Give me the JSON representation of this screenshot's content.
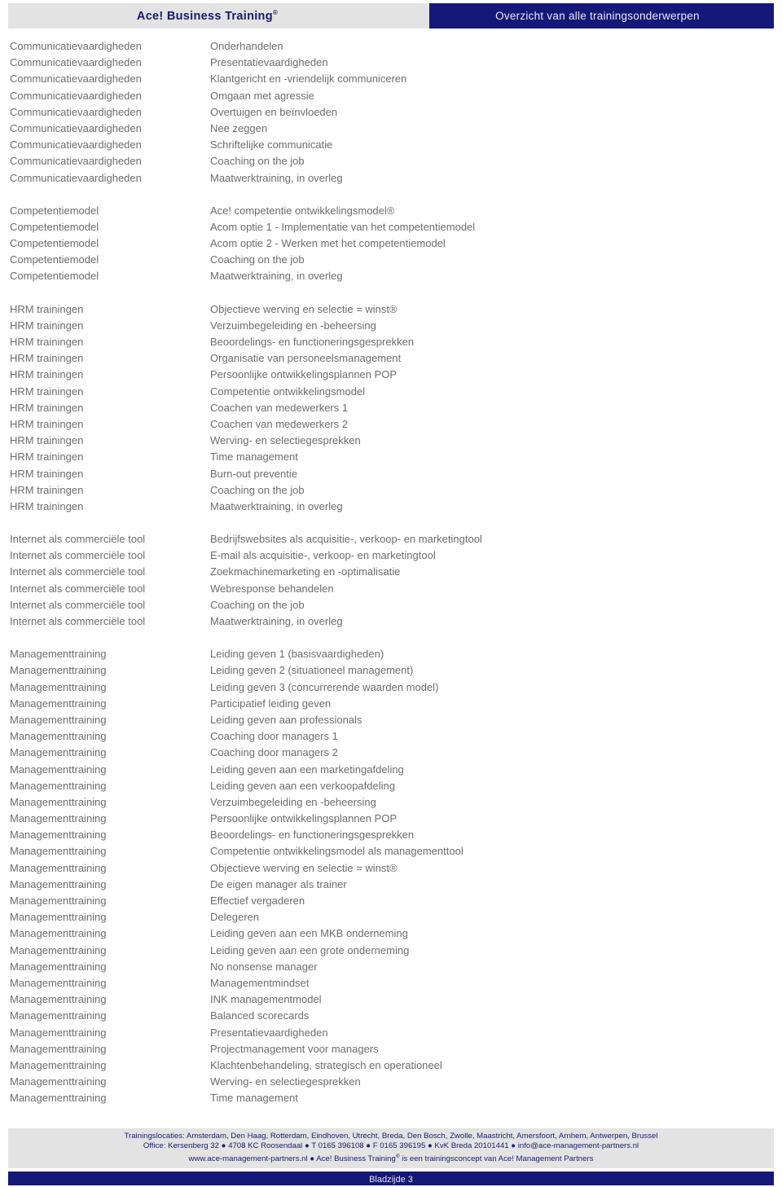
{
  "header": {
    "brand": "Ace! Business Training",
    "brand_mark": "®",
    "title": "Overzicht van alle trainingsonderwerpen"
  },
  "groups": [
    {
      "category": "Communicatievaardigheden",
      "rows": [
        {
          "category": "Communicatievaardigheden",
          "topic": "Onderhandelen"
        },
        {
          "category": "Communicatievaardigheden",
          "topic": "Presentatievaardigheden"
        },
        {
          "category": "Communicatievaardigheden",
          "topic": "Klantgericht en -vriendelijk communiceren"
        },
        {
          "category": "Communicatievaardigheden",
          "topic": "Omgaan met agressie"
        },
        {
          "category": "Communicatievaardigheden",
          "topic": "Overtuigen en beïnvloeden"
        },
        {
          "category": "Communicatievaardigheden",
          "topic": "Nee zeggen"
        },
        {
          "category": "Communicatievaardigheden",
          "topic": "Schriftelijke communicatie"
        },
        {
          "category": "Communicatievaardigheden",
          "topic": "Coaching on the job"
        },
        {
          "category": "Communicatievaardigheden",
          "topic": "Maatwerktraining, in overleg"
        }
      ]
    },
    {
      "category": "Competentiemodel",
      "rows": [
        {
          "category": "Competentiemodel",
          "topic": "Ace! competentie ontwikkelingsmodel®"
        },
        {
          "category": "Competentiemodel",
          "topic": "Acom optie 1 - Implementatie van het competentiemodel"
        },
        {
          "category": "Competentiemodel",
          "topic": "Acom optie 2 - Werken met het competentiemodel"
        },
        {
          "category": "Competentiemodel",
          "topic": "Coaching on the job"
        },
        {
          "category": "Competentiemodel",
          "topic": "Maatwerktraining, in overleg"
        }
      ]
    },
    {
      "category": "HRM trainingen",
      "rows": [
        {
          "category": "HRM trainingen",
          "topic": "Objectieve werving en selectie = winst®"
        },
        {
          "category": "HRM trainingen",
          "topic": "Verzuimbegeleiding en -beheersing"
        },
        {
          "category": "HRM trainingen",
          "topic": "Beoordelings- en functioneringsgesprekken"
        },
        {
          "category": "HRM trainingen",
          "topic": "Organisatie van personeelsmanagement"
        },
        {
          "category": "HRM trainingen",
          "topic": "Persoonlijke ontwikkelingsplannen POP"
        },
        {
          "category": "HRM trainingen",
          "topic": "Competentie ontwikkelingsmodel"
        },
        {
          "category": "HRM trainingen",
          "topic": "Coachen van medewerkers 1"
        },
        {
          "category": "HRM trainingen",
          "topic": "Coachen van medewerkers 2"
        },
        {
          "category": "HRM trainingen",
          "topic": "Werving- en selectiegesprekken"
        },
        {
          "category": "HRM trainingen",
          "topic": "Time management"
        },
        {
          "category": "HRM trainingen",
          "topic": "Burn-out preventie"
        },
        {
          "category": "HRM trainingen",
          "topic": "Coaching on the job"
        },
        {
          "category": "HRM trainingen",
          "topic": "Maatwerktraining, in overleg"
        }
      ]
    },
    {
      "category": "Internet als commerciële tool",
      "rows": [
        {
          "category": "Internet als commerciële tool",
          "topic": "Bedrijfswebsites als acquisitie-, verkoop- en marketingtool"
        },
        {
          "category": "Internet als commerciële tool",
          "topic": "E-mail als acquisitie-, verkoop- en marketingtool"
        },
        {
          "category": "Internet als commerciële tool",
          "topic": "Zoekmachinemarketing en -optimalisatie"
        },
        {
          "category": "Internet als commerciële tool",
          "topic": "Webresponse behandelen"
        },
        {
          "category": "Internet als commerciële tool",
          "topic": "Coaching on the job"
        },
        {
          "category": "Internet als commerciële tool",
          "topic": "Maatwerktraining, in overleg"
        }
      ]
    },
    {
      "category": "Managementtraining",
      "rows": [
        {
          "category": "Managementtraining",
          "topic": "Leiding geven 1 (basisvaardigheden)"
        },
        {
          "category": "Managementtraining",
          "topic": "Leiding geven 2 (situationeel management)"
        },
        {
          "category": "Managementtraining",
          "topic": "Leiding geven 3 (concurrerende waarden model)"
        },
        {
          "category": "Managementtraining",
          "topic": "Participatief leiding geven"
        },
        {
          "category": "Managementtraining",
          "topic": "Leiding geven aan professionals"
        },
        {
          "category": "Managementtraining",
          "topic": "Coaching door managers 1"
        },
        {
          "category": "Managementtraining",
          "topic": "Coaching door managers 2"
        },
        {
          "category": "Managementtraining",
          "topic": "Leiding geven aan een marketingafdeling"
        },
        {
          "category": "Managementtraining",
          "topic": "Leiding geven aan een verkoopafdeling"
        },
        {
          "category": "Managementtraining",
          "topic": "Verzuimbegeleiding en -beheersing"
        },
        {
          "category": "Managementtraining",
          "topic": "Persoonlijke ontwikkelingsplannen POP"
        },
        {
          "category": "Managementtraining",
          "topic": "Beoordelings- en functioneringsgesprekken"
        },
        {
          "category": "Managementtraining",
          "topic": "Competentie ontwikkelingsmodel als managementtool"
        },
        {
          "category": "Managementtraining",
          "topic": "Objectieve werving en selectie = winst®"
        },
        {
          "category": "Managementtraining",
          "topic": "De eigen manager als trainer"
        },
        {
          "category": "Managementtraining",
          "topic": "Effectief vergaderen"
        },
        {
          "category": "Managementtraining",
          "topic": "Delegeren"
        },
        {
          "category": "Managementtraining",
          "topic": "Leiding geven aan een MKB onderneming"
        },
        {
          "category": "Managementtraining",
          "topic": "Leiding geven aan een grote onderneming"
        },
        {
          "category": "Managementtraining",
          "topic": "No nonsense manager"
        },
        {
          "category": "Managementtraining",
          "topic": "Managementmindset"
        },
        {
          "category": "Managementtraining",
          "topic": "INK managementmodel"
        },
        {
          "category": "Managementtraining",
          "topic": "Balanced scorecards"
        },
        {
          "category": "Managementtraining",
          "topic": "Presentatievaardigheden"
        },
        {
          "category": "Managementtraining",
          "topic": "Projectmanagement voor managers"
        },
        {
          "category": "Managementtraining",
          "topic": "Klachtenbehandeling, strategisch en operationeel"
        },
        {
          "category": "Managementtraining",
          "topic": "Werving- en selectiegesprekken"
        },
        {
          "category": "Managementtraining",
          "topic": "Time management"
        }
      ]
    }
  ],
  "footer": {
    "locations_line": "Trainingslocaties: Amsterdam, Den Haag, Rotterdam, Eindhoven, Utrecht, Breda, Den Bosch, Zwolle, Maastricht, Amersfoort, Arnhem, Antwerpen, Brussel",
    "office_line": "Office: Kersenberg 32 ● 4708 KC Roosendaal ● T 0165 396108 ● F 0165 396195 ● KvK Breda 20101441 ● info@ace-management-partners.nl",
    "web_line_before": "www.ace-management-partners.nl ● Ace! Business Training",
    "web_line_mark": "®",
    "web_line_after": " is een trainingsconcept van Ace! Management Partners",
    "page_label": "Bladzijde 3"
  },
  "colors": {
    "navy": "#141878",
    "header_gray": "#e3e3e3",
    "body_text": "#6d6d6d",
    "footer_text": "#1b2170"
  }
}
